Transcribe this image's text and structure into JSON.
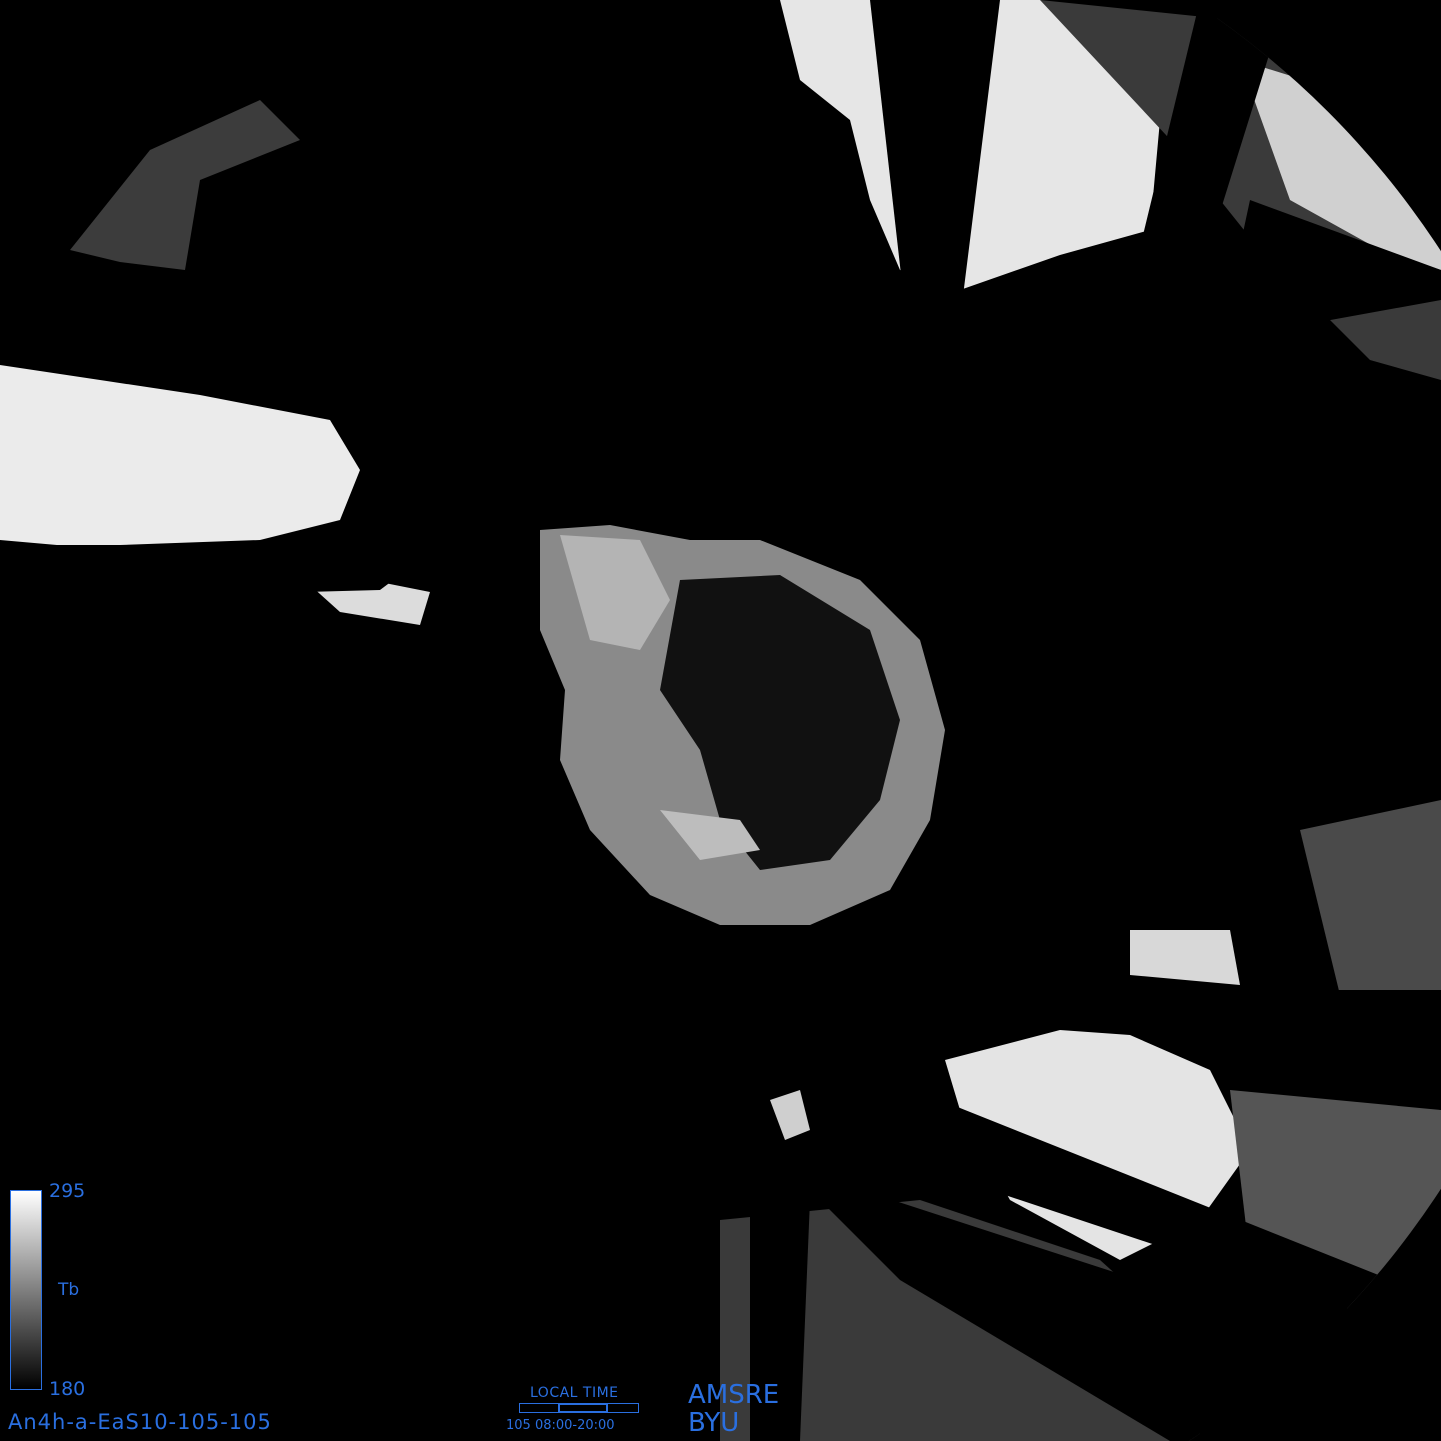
{
  "image": {
    "kind": "polar stereographic brightness temperature mosaic (south pole)",
    "background_color": "#000000"
  },
  "colorbar": {
    "max_label": "295",
    "min_label": "180",
    "unit_label": "Tb",
    "top_color": "#ffffff",
    "bottom_color": "#000000",
    "border_color": "#2a6fe0"
  },
  "product_id": "An4h-a-EaS10-105-105",
  "local_time": {
    "title": "LOCAL TIME",
    "range": "105 08:00-20:00"
  },
  "sensor": "AMSRE",
  "institution": "BYU",
  "label_color": "#2a6fe0"
}
